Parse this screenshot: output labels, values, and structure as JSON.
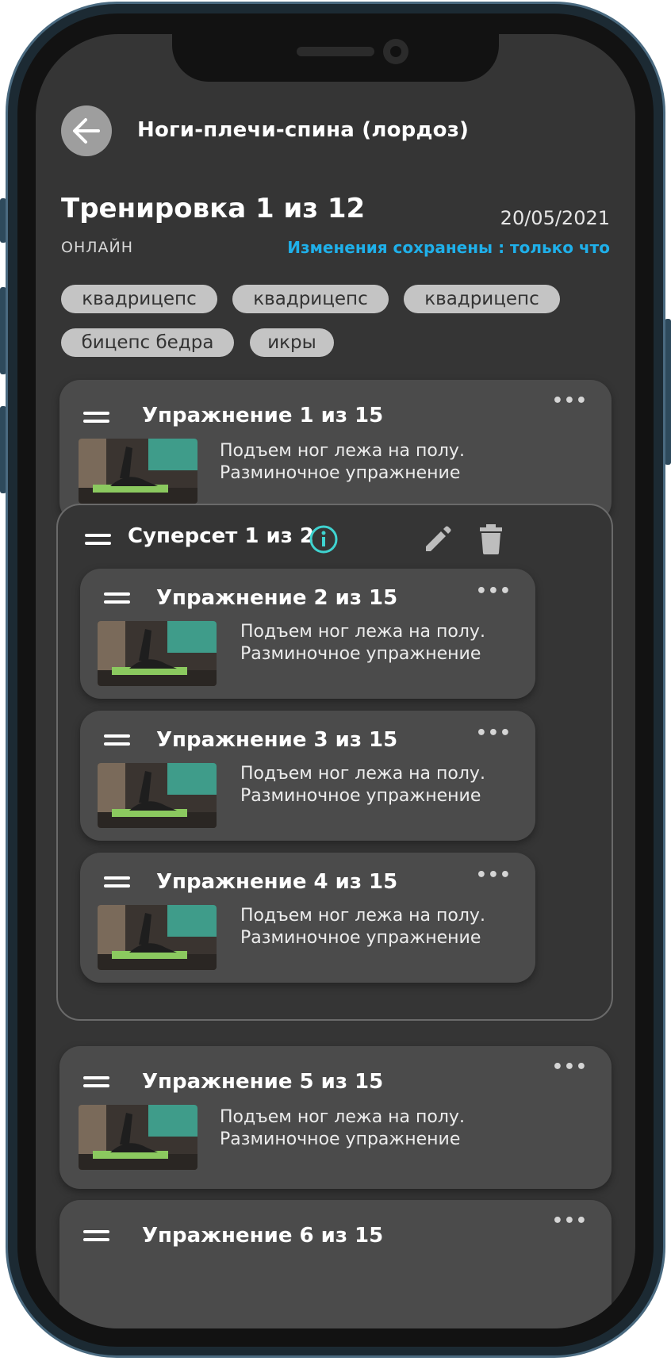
{
  "header": {
    "title": "Ноги-плечи-спина (лордоз)"
  },
  "workout": {
    "title": "Тренировка 1 из 12",
    "date": "20/05/2021",
    "mode": "ОНЛАЙН",
    "saved_status": "Изменения сохранены : только что"
  },
  "tags": [
    "квадрицепс",
    "квадрицепс",
    "квадрицепс",
    "бицепс бедра",
    "икры"
  ],
  "exercises": [
    {
      "title": "Упражнение 1 из 15",
      "line1": "Подъем ног лежа на полу.",
      "line2": "Разминочное упражнение"
    },
    {
      "title": "Упражнение 2 из 15",
      "line1": "Подъем ног лежа на полу.",
      "line2": "Разминочное упражнение"
    },
    {
      "title": "Упражнение 3 из 15",
      "line1": "Подъем ног лежа на полу.",
      "line2": "Разминочное упражнение"
    },
    {
      "title": "Упражнение 4 из 15",
      "line1": "Подъем ног лежа на полу.",
      "line2": "Разминочное упражнение"
    },
    {
      "title": "Упражнение 5 из 15",
      "line1": "Подъем ног лежа на полу.",
      "line2": "Разминочное упражнение"
    },
    {
      "title": "Упражнение 6 из 15"
    }
  ],
  "superset": {
    "title": "Суперсет 1 из 2"
  },
  "more_label": "•••",
  "icons": {
    "back": "arrow-left-icon",
    "info": "info-icon",
    "edit": "pencil-icon",
    "delete": "trash-icon",
    "drag": "drag-handle-icon",
    "more": "more-horizontal-icon"
  },
  "colors": {
    "background": "#353535",
    "card": "#4b4b4b",
    "accent_saved": "#1fb0ea",
    "accent_info": "#3fd3d0",
    "tag": "#c4c4c4"
  }
}
